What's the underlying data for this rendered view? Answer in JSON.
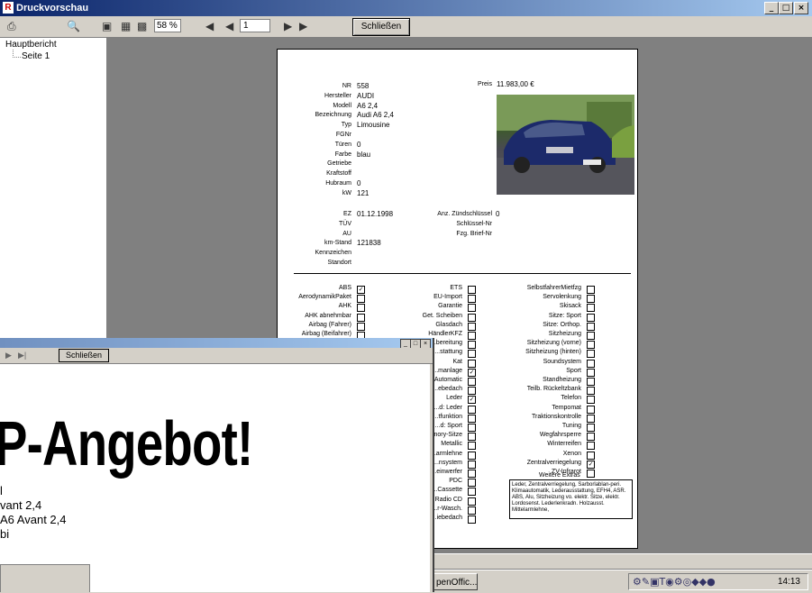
{
  "window": {
    "title": "Druckvorschau",
    "app_icon": "R"
  },
  "toolbar": {
    "zoom": "58 %",
    "page": "1",
    "close_label": "Schließen"
  },
  "tree": {
    "root": "Hauptbericht",
    "child": "Seite 1"
  },
  "report": {
    "left": [
      {
        "label": "NR",
        "value": "558"
      },
      {
        "label": "Hersteller",
        "value": "AUDI"
      },
      {
        "label": "Modell",
        "value": "A6 2,4"
      },
      {
        "label": "Bezeichnung",
        "value": "Audi A6 2,4"
      },
      {
        "label": "Typ",
        "value": "Limousine"
      },
      {
        "label": "FGNr",
        "value": ""
      },
      {
        "label": "Türen",
        "value": "0"
      },
      {
        "label": "Farbe",
        "value": "blau"
      },
      {
        "label": "Getriebe",
        "value": ""
      },
      {
        "label": "Kraftstoff",
        "value": ""
      },
      {
        "label": "Hubraum",
        "value": "0"
      },
      {
        "label": "kW",
        "value": "121"
      }
    ],
    "price_label": "Preis",
    "price_value": "11.983,00 €",
    "left2": [
      {
        "label": "EZ",
        "value": "01.12.1998"
      },
      {
        "label": "TÜV",
        "value": ""
      },
      {
        "label": "AU",
        "value": ""
      },
      {
        "label": "km-Stand",
        "value": "121838"
      },
      {
        "label": "Kennzeichen",
        "value": ""
      },
      {
        "label": "Standort",
        "value": ""
      }
    ],
    "mid2": [
      {
        "label": "Anz. Zündschlüssel",
        "value": "0"
      },
      {
        "label": "Schlüssel-Nr",
        "value": ""
      },
      {
        "label": "Fzg. Brief-Nr",
        "value": ""
      }
    ],
    "col1": [
      {
        "label": "ABS",
        "checked": true
      },
      {
        "label": "AerodynamikPaket",
        "checked": false
      },
      {
        "label": "AHK",
        "checked": false
      },
      {
        "label": "AHK abnehmbar",
        "checked": false
      },
      {
        "label": "Airbag (Fahrer)",
        "checked": false
      },
      {
        "label": "Airbag (Beifahrer)",
        "checked": false
      }
    ],
    "col2": [
      {
        "label": "ETS",
        "checked": false
      },
      {
        "label": "EU-Import",
        "checked": false
      },
      {
        "label": "Garantie",
        "checked": false
      },
      {
        "label": "Get. Scheiben",
        "checked": false
      },
      {
        "label": "Glasdach",
        "checked": false
      },
      {
        "label": "HändlerKFZ",
        "checked": false
      },
      {
        "label": "...bereitung",
        "checked": false
      },
      {
        "label": "...stattung",
        "checked": false
      },
      {
        "label": "Kat",
        "checked": false
      },
      {
        "label": "...manlage",
        "checked": true
      },
      {
        "label": "...Automatic",
        "checked": false
      },
      {
        "label": "...ebedach",
        "checked": false
      },
      {
        "label": "Leder",
        "checked": true
      },
      {
        "label": "...d: Leder",
        "checked": false
      },
      {
        "label": "...tfunktion",
        "checked": false
      },
      {
        "label": "...d: Sport",
        "checked": false
      },
      {
        "label": "...nory-Sitze",
        "checked": false
      },
      {
        "label": "Metallic",
        "checked": false
      },
      {
        "label": "...armlehne",
        "checked": false
      },
      {
        "label": "...nsystem",
        "checked": false
      },
      {
        "label": "...einwerfer",
        "checked": false
      },
      {
        "label": "PDC",
        "checked": false
      },
      {
        "label": "...Cassette",
        "checked": false
      },
      {
        "label": "Radio CD",
        "checked": false
      },
      {
        "label": "...r-Wasch.",
        "checked": false
      },
      {
        "label": "...iebedach",
        "checked": false
      }
    ],
    "col3": [
      {
        "label": "SelbstfahrerMietfzg",
        "checked": false
      },
      {
        "label": "Servolenkung",
        "checked": false
      },
      {
        "label": "Skisack",
        "checked": false
      },
      {
        "label": "Sitze: Sport",
        "checked": false
      },
      {
        "label": "Sitze: Orthop.",
        "checked": false
      },
      {
        "label": "Sitzheizung",
        "checked": false
      },
      {
        "label": "Sitzheizung (vorne)",
        "checked": false
      },
      {
        "label": "Sitzheizung (hinten)",
        "checked": false
      },
      {
        "label": "Soundsystem",
        "checked": false
      },
      {
        "label": "Sport",
        "checked": false
      },
      {
        "label": "Standheizung",
        "checked": false
      },
      {
        "label": "Teilb. Rückeltzbank",
        "checked": false
      },
      {
        "label": "Telefon",
        "checked": false
      },
      {
        "label": "Tempomat",
        "checked": false
      },
      {
        "label": "Traktionskontrolle",
        "checked": false
      },
      {
        "label": "Tuning",
        "checked": false
      },
      {
        "label": "Wegfahrsperre",
        "checked": false
      },
      {
        "label": "Winterreifen",
        "checked": false
      },
      {
        "label": "Xenon",
        "checked": false
      },
      {
        "label": "Zentralverriegelung",
        "checked": true
      },
      {
        "label": "ZV-Infrarot",
        "checked": false
      }
    ],
    "extras_title": "Weitere Extras",
    "extras_text": "Leder, Zentralverriegelung, Sarborlablan-peri. Klimaautomatik, Lederausstattung, EFH4, ASR. ABS, Alu, Sitzheizung vo. elektr. Sitze, elektr. Lordosenst. Lederlenkradn. Holzausst. Mittelarmlehne,"
  },
  "win2": {
    "close_label": "Schließen",
    "headline": "P-Angebot!",
    "lines": [
      "l",
      "vant 2,4",
      " A6 Avant 2,4",
      "bi"
    ]
  },
  "taskbar": {
    "item": "penOffic...",
    "clock": "14:13"
  }
}
